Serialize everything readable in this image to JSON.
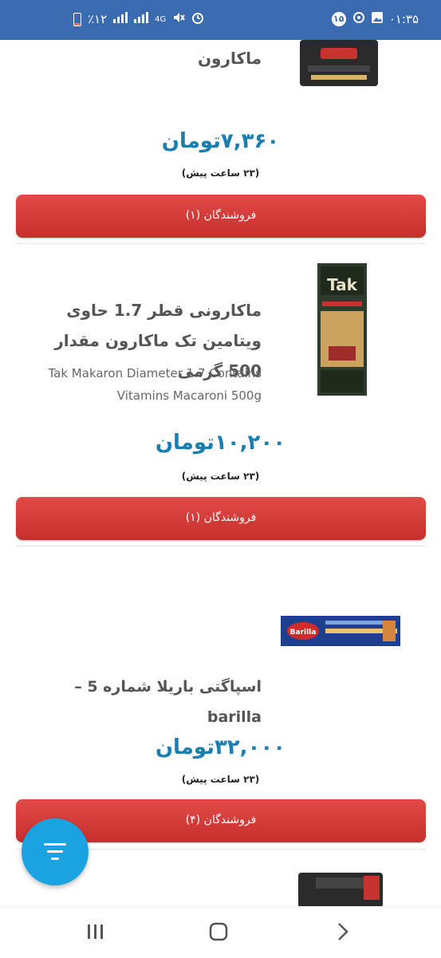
{
  "status_bar": {
    "time": "۰۱:۳۵",
    "badge": "۱۵",
    "signal_text": "4G",
    "battery_percent": "٪۱۲"
  },
  "products": [
    {
      "title": "ماکارون",
      "subtitle": "",
      "price": "۷,۳۶۰تومان",
      "time_ago": "(۲۳ ساعت پیش)",
      "sellers_label": "فروشندگان (۱)"
    },
    {
      "title": "ماکارونی قطر 1.7 حاوی ویتامین تک ماکارون مقدار 500 گرمی",
      "subtitle": "Tak Makaron Diameter 1.7 Contains Vitamins Macaroni 500g",
      "price": "۱۰,۲۰۰تومان",
      "time_ago": "(۲۳ ساعت پیش)",
      "sellers_label": "فروشندگان (۱)"
    },
    {
      "title": "اسپاگتی باریلا شماره 5 – barilla",
      "subtitle": "",
      "price": "۳۲,۰۰۰تومان",
      "time_ago": "(۲۳ ساعت پیش)",
      "sellers_label": "فروشندگان (۴)"
    }
  ],
  "colors": {
    "status_bar": "#3a6bb0",
    "price": "#1a7fb0",
    "button": "#d63c39",
    "fab": "#1aa3e0"
  },
  "icons": {
    "fab": "filter-icon",
    "nav_recent": "recent-apps-icon",
    "nav_home": "home-icon",
    "nav_back": "back-icon"
  }
}
